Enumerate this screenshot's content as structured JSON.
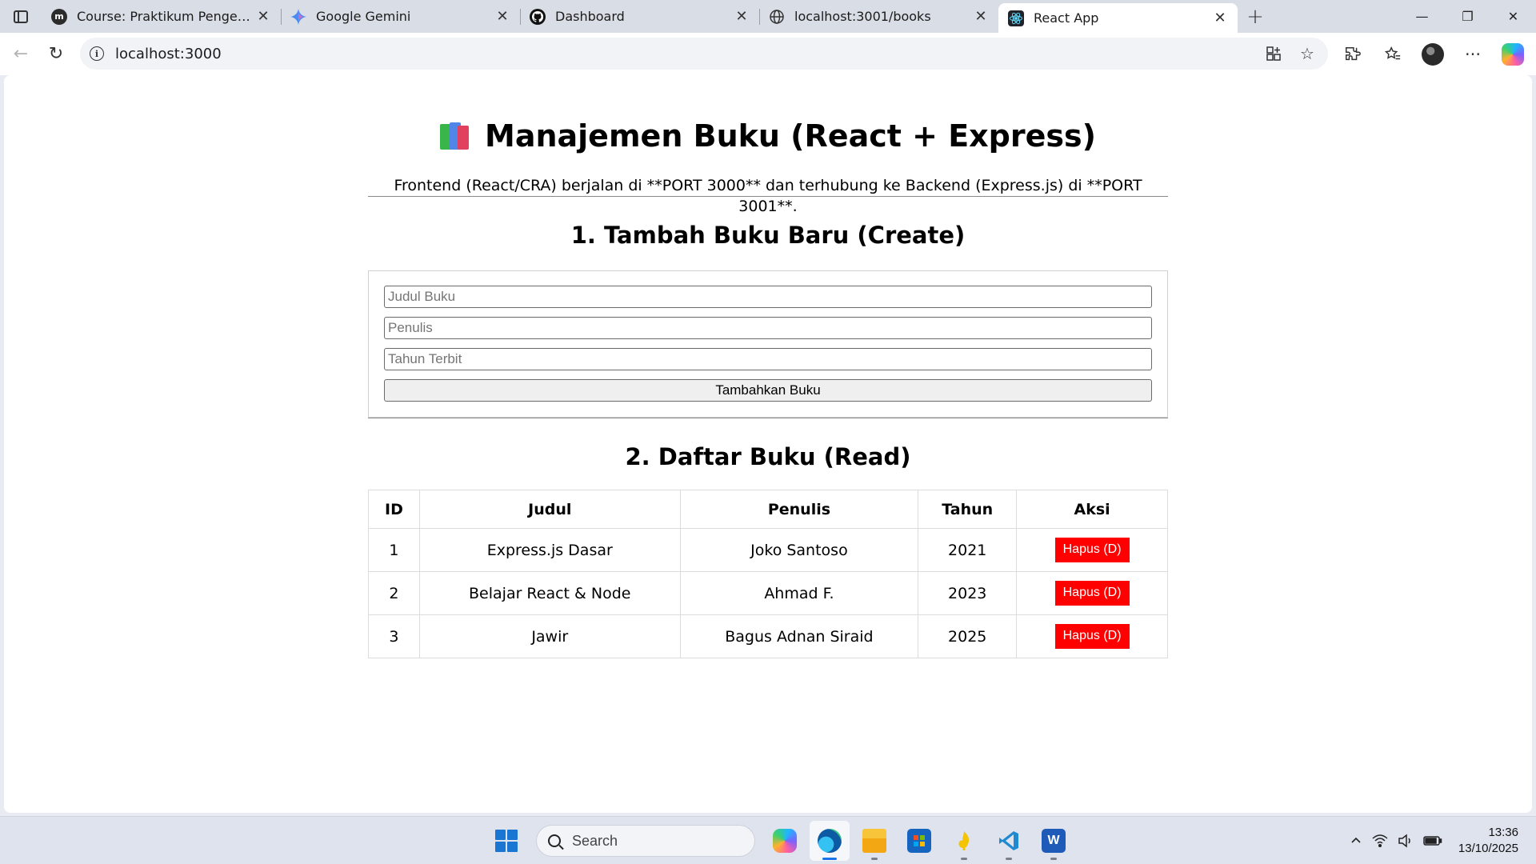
{
  "browser": {
    "tabs": [
      {
        "title": "Course: Praktikum Pengembangan",
        "favicon": "moodle-icon",
        "active": false
      },
      {
        "title": "Google Gemini",
        "favicon": "gemini-icon",
        "active": false
      },
      {
        "title": "Dashboard",
        "favicon": "github-icon",
        "active": false
      },
      {
        "title": "localhost:3001/books",
        "favicon": "globe-icon",
        "active": false
      },
      {
        "title": "React App",
        "favicon": "react-icon",
        "active": true
      }
    ],
    "address": "localhost:3000"
  },
  "page": {
    "title": "Manajemen Buku (React + Express)",
    "title_icon": "books-emoji",
    "intro": "Frontend (React/CRA) berjalan di **PORT 3000** dan terhubung ke Backend (Express.js) di **PORT 3001**.",
    "create_section": {
      "heading": "1. Tambah Buku Baru (Create)",
      "fields": {
        "title_placeholder": "Judul Buku",
        "author_placeholder": "Penulis",
        "year_placeholder": "Tahun Terbit",
        "title_value": "",
        "author_value": "",
        "year_value": ""
      },
      "submit_label": "Tambahkan Buku"
    },
    "read_section": {
      "heading": "2. Daftar Buku (Read)",
      "columns": [
        "ID",
        "Judul",
        "Penulis",
        "Tahun",
        "Aksi"
      ],
      "rows": [
        {
          "id": "1",
          "judul": "Express.js Dasar",
          "penulis": "Joko Santoso",
          "tahun": "2021",
          "aksi": "Hapus (D)"
        },
        {
          "id": "2",
          "judul": "Belajar React & Node",
          "penulis": "Ahmad F.",
          "tahun": "2023",
          "aksi": "Hapus (D)"
        },
        {
          "id": "3",
          "judul": "Jawir",
          "penulis": "Bagus Adnan Siraid",
          "tahun": "2025",
          "aksi": "Hapus (D)"
        }
      ],
      "delete_color": "#ff0000"
    }
  },
  "taskbar": {
    "search_label": "Search",
    "time": "13:36",
    "date": "13/10/2025"
  }
}
